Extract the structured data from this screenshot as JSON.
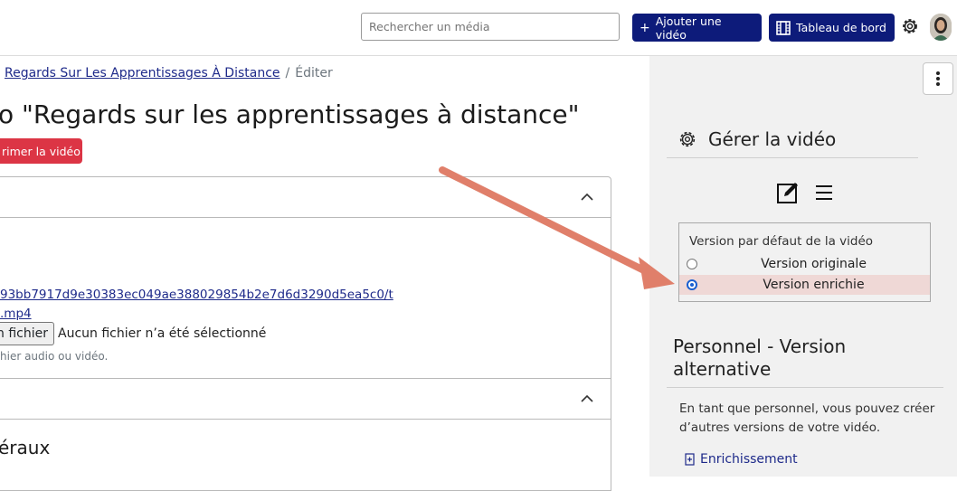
{
  "header": {
    "search_placeholder": "Rechercher un média",
    "add_video_label": "Ajouter une vidéo",
    "dashboard_label": "Tableau de bord"
  },
  "breadcrumb": {
    "parent": "Regards Sur Les Apprentissages À Distance",
    "separator": "/",
    "current": "Éditer"
  },
  "main": {
    "title": "o \"Regards sur les apprentissages à distance\"",
    "delete_label": "rimer la vidéo",
    "file_link_1": "93bb7917d9e30383ec049ae388029854b2e7d6d3290d5ea5c0/t",
    "file_link_2": ".mp4",
    "file_button_label": "n fichier",
    "file_status": "Aucun fichier n’a été sélectionné",
    "file_help": "hier audio ou vidéo.",
    "section2_title": "éraux"
  },
  "aside": {
    "manage_title": "Gérer la vidéo",
    "version_legend": "Version par défaut de la vidéo",
    "versions": [
      {
        "label": "Version originale",
        "selected": false
      },
      {
        "label": "Version enrichie",
        "selected": true
      }
    ],
    "alt_title": "Personnel - Version alternative",
    "alt_text": "En tant que personnel, vous pouvez créer d’autres versions de votre vidéo.",
    "enrich_label": "Enrichissement"
  },
  "colors": {
    "navy": "#0d1b7a",
    "danger": "#dc3545",
    "link": "#1e2a8a",
    "arrow": "#e07f6a",
    "selected_row": "#efd8d6"
  }
}
